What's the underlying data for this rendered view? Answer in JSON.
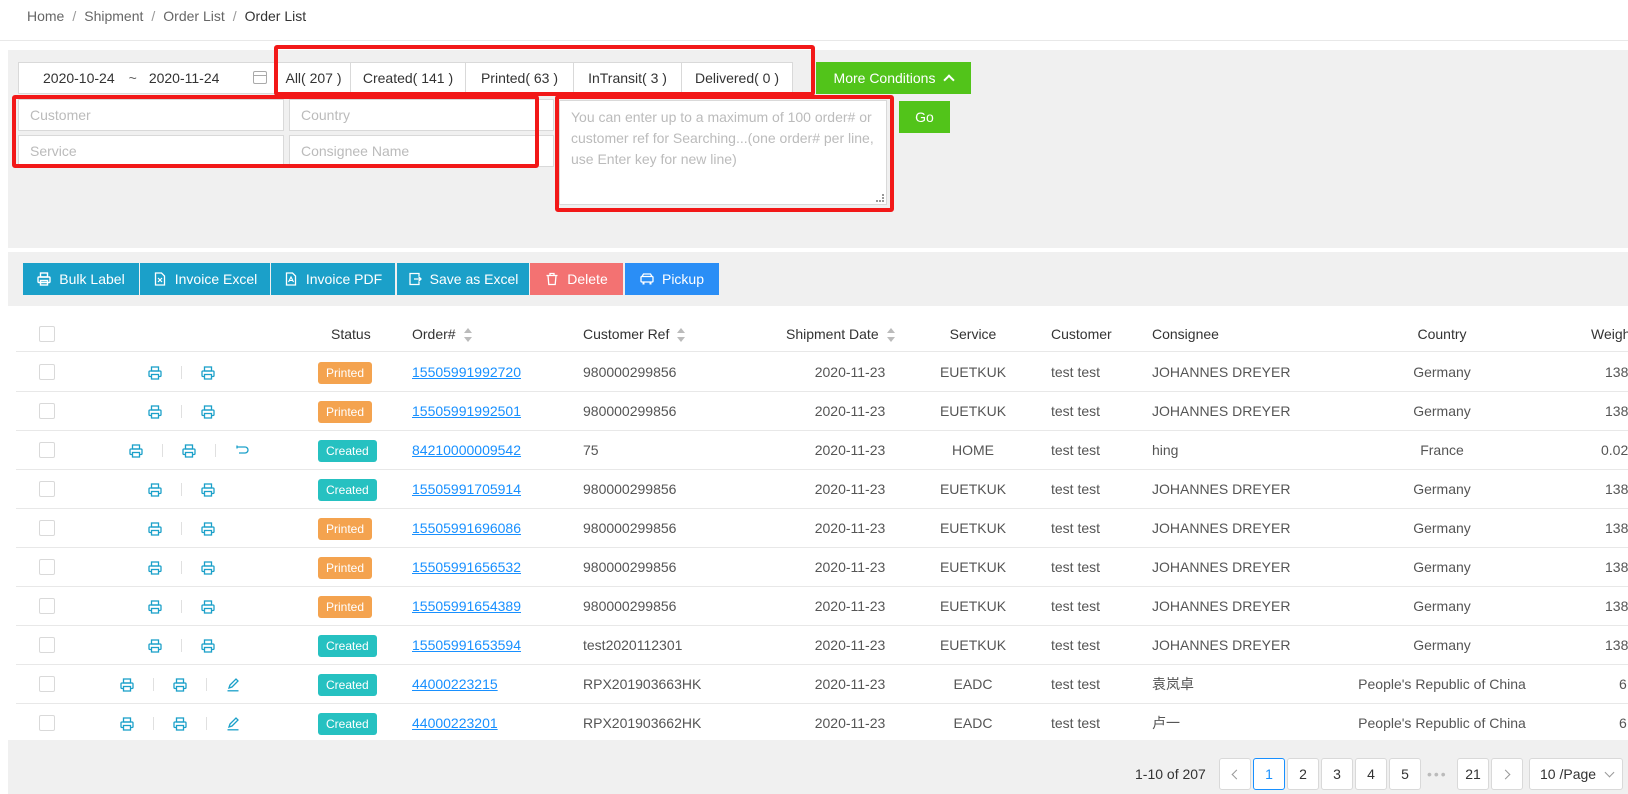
{
  "breadcrumb": [
    "Home",
    "Shipment",
    "Order List",
    "Order List"
  ],
  "filters": {
    "date_start": "2020-10-24",
    "date_separator": "~",
    "date_end": "2020-11-24",
    "status_tabs": [
      "All( 207 )",
      "Created( 141 )",
      "Printed( 63 )",
      "InTransit( 3 )",
      "Delivered( 0 )"
    ],
    "more_conditions": "More Conditions",
    "customer_placeholder": "Customer",
    "country_placeholder": "Country",
    "service_placeholder": "Service",
    "consignee_placeholder": "Consignee Name",
    "search_placeholder": "You can enter up to a maximum of 100 order# or customer ref for Searching...(one order# per line, use Enter key for new line)",
    "go": "Go"
  },
  "toolbar": {
    "bulk_label": "Bulk Label",
    "invoice_excel": "Invoice Excel",
    "invoice_pdf": "Invoice PDF",
    "save_as_excel": "Save as Excel",
    "delete": "Delete",
    "pickup": "Pickup"
  },
  "table": {
    "headers": {
      "status": "Status",
      "order": "Order#",
      "customer_ref": "Customer Ref",
      "shipment_date": "Shipment Date",
      "service": "Service",
      "customer": "Customer",
      "consignee": "Consignee",
      "country": "Country",
      "weight": "Weight"
    },
    "rows": [
      {
        "status": "Printed",
        "order": "15505991992720",
        "ref": "980000299856",
        "date": "2020-11-23",
        "service": "EUETKUK",
        "customer": "test test",
        "consignee": "JOHANNES DREYER",
        "country": "Germany",
        "weight": "138"
      },
      {
        "status": "Printed",
        "order": "15505991992501",
        "ref": "980000299856",
        "date": "2020-11-23",
        "service": "EUETKUK",
        "customer": "test test",
        "consignee": "JOHANNES DREYER",
        "country": "Germany",
        "weight": "138"
      },
      {
        "status": "Created",
        "order": "84210000009542",
        "ref": "75",
        "date": "2020-11-23",
        "service": "HOME",
        "customer": "test test",
        "consignee": "hing",
        "country": "France",
        "weight": "0.02"
      },
      {
        "status": "Created",
        "order": "15505991705914",
        "ref": "980000299856",
        "date": "2020-11-23",
        "service": "EUETKUK",
        "customer": "test test",
        "consignee": "JOHANNES DREYER",
        "country": "Germany",
        "weight": "138"
      },
      {
        "status": "Printed",
        "order": "15505991696086",
        "ref": "980000299856",
        "date": "2020-11-23",
        "service": "EUETKUK",
        "customer": "test test",
        "consignee": "JOHANNES DREYER",
        "country": "Germany",
        "weight": "138"
      },
      {
        "status": "Printed",
        "order": "15505991656532",
        "ref": "980000299856",
        "date": "2020-11-23",
        "service": "EUETKUK",
        "customer": "test test",
        "consignee": "JOHANNES DREYER",
        "country": "Germany",
        "weight": "138"
      },
      {
        "status": "Printed",
        "order": "15505991654389",
        "ref": "980000299856",
        "date": "2020-11-23",
        "service": "EUETKUK",
        "customer": "test test",
        "consignee": "JOHANNES DREYER",
        "country": "Germany",
        "weight": "138"
      },
      {
        "status": "Created",
        "order": "15505991653594",
        "ref": "test2020112301",
        "date": "2020-11-23",
        "service": "EUETKUK",
        "customer": "test test",
        "consignee": "JOHANNES DREYER",
        "country": "Germany",
        "weight": "138"
      },
      {
        "status": "Created",
        "order": "44000223215",
        "ref": "RPX201903663HK",
        "date": "2020-11-23",
        "service": "EADC",
        "customer": "test test",
        "consignee": "袁岚卓",
        "country": "People's Republic of China",
        "weight": "6"
      },
      {
        "status": "Created",
        "order": "44000223201",
        "ref": "RPX201903662HK",
        "date": "2020-11-23",
        "service": "EADC",
        "customer": "test test",
        "consignee": "卢一",
        "country": "People's Republic of China",
        "weight": "6"
      }
    ]
  },
  "pagination": {
    "summary": "1-10 of 207",
    "pages": [
      "1",
      "2",
      "3",
      "4",
      "5"
    ],
    "ellipsis": "•••",
    "last_page": "21",
    "current": "1",
    "page_size": "10 /Page"
  },
  "colors": {
    "printed": "#f4a34f",
    "created": "#26c1c1",
    "link": "#1890ff",
    "green": "#52c41a",
    "teal_button": "#1ba0c9",
    "delete_button": "#f37272",
    "pickup_button": "#2a8ef6",
    "highlight_box": "#f21818"
  },
  "icons": {
    "print": "printer-icon",
    "return": "return-icon",
    "edit": "edit-icon",
    "calendar": "calendar-icon"
  }
}
